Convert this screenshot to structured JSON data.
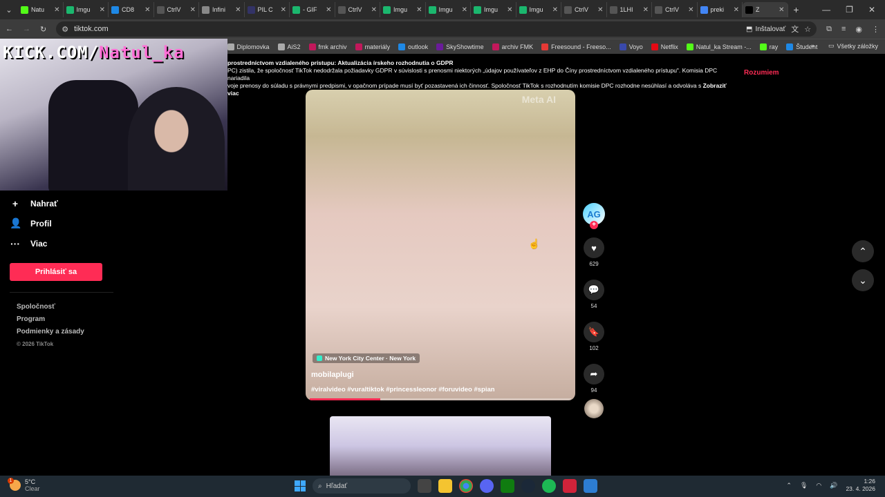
{
  "browser": {
    "tabs": [
      {
        "title": "Natu",
        "color": "#53fc18"
      },
      {
        "title": "Imgu",
        "color": "#1bb76e"
      },
      {
        "title": "CD8",
        "color": "#1e88e5"
      },
      {
        "title": "CtrlV",
        "color": "#555555"
      },
      {
        "title": "Infini",
        "color": "#888888"
      },
      {
        "title": "PIL C",
        "color": "#333366"
      },
      {
        "title": "- GIF",
        "color": "#1bb76e"
      },
      {
        "title": "CtrlV",
        "color": "#555555"
      },
      {
        "title": "Imgu",
        "color": "#1bb76e"
      },
      {
        "title": "Imgu",
        "color": "#1bb76e"
      },
      {
        "title": "Imgu",
        "color": "#1bb76e"
      },
      {
        "title": "Imgu",
        "color": "#1bb76e"
      },
      {
        "title": "CtrlV",
        "color": "#555555"
      },
      {
        "title": "1LHI",
        "color": "#555555"
      },
      {
        "title": "CtrlV",
        "color": "#555555"
      },
      {
        "title": "preki",
        "color": "#4285f4"
      },
      {
        "title": "Z",
        "color": "#000000",
        "active": true
      }
    ],
    "url": "tiktok.com",
    "install_label": "Inštalovať",
    "bookmarks": [
      {
        "label": "Diplomovka",
        "color": "#aaaaaa"
      },
      {
        "label": "AiS2",
        "color": "#aaaaaa"
      },
      {
        "label": "fmk archiv",
        "color": "#c2185b"
      },
      {
        "label": "materiály",
        "color": "#c2185b"
      },
      {
        "label": "outlook",
        "color": "#1e88e5"
      },
      {
        "label": "SkyShowtime",
        "color": "#6a1b9a"
      },
      {
        "label": "archiv FMK",
        "color": "#c2185b"
      },
      {
        "label": "Freesound - Freeso...",
        "color": "#e53935"
      },
      {
        "label": "Voyo",
        "color": "#3949ab"
      },
      {
        "label": "Netflix",
        "color": "#e50914"
      },
      {
        "label": "Natul_ka Stream -...",
        "color": "#53fc18"
      },
      {
        "label": "ray",
        "color": "#53fc18"
      },
      {
        "label": "Študent",
        "color": "#1e88e5"
      }
    ],
    "bookmarks_all": "Všetky záložky",
    "bookmarks_cut": "x"
  },
  "overlay": {
    "kick_prefix": "KICK.COM/",
    "kick_name": "Natul_ka"
  },
  "banner": {
    "title": "prostredníctvom vzdialeného prístupu: Aktualizácia írskeho rozhodnutia o GDPR",
    "line1": "PC) zistila, že spoločnosť TikTok nedodržala požiadavky GDPR v súvislosti s prenosmi niektorých „údajov používateľov z EHP do Číny prostredníctvom vzdialeného prístupu\". Komisia DPC nariadila",
    "line2": "voje prenosy do súladu s právnymi predpismi, v opačnom prípade musí byť pozastavená ich činnosť. Spoločnosť TikTok s rozhodnutím komisie DPC rozhodne nesúhlasí a odvoláva s",
    "more": "Zobraziť viac",
    "accept": "Rozumiem"
  },
  "sidebar": {
    "items": [
      {
        "label": "Nahrať",
        "icon": "+"
      },
      {
        "label": "Profil",
        "icon": "👤"
      },
      {
        "label": "Viac",
        "icon": "···"
      }
    ],
    "login": "Prihlásiť sa",
    "links": [
      "Spoločnosť",
      "Program",
      "Podmienky a zásady"
    ],
    "copyright": "© 2026 TikTok"
  },
  "video": {
    "watermark": "Meta AI",
    "location": "New York City Center · New York",
    "author": "mobilaplugi",
    "tags": "#viralvideo #vuraltiktok #princessleonor #foruvideo #spian",
    "progress": 0.27
  },
  "actions": {
    "avatar_text": "AG",
    "likes": "629",
    "comments": "54",
    "saves": "102",
    "shares": "94"
  },
  "taskbar": {
    "temp": "5°C",
    "weather": "Clear",
    "weather_badge": "1",
    "search_placeholder": "Hľadať",
    "time": "1:26",
    "date": "23. 4. 2026"
  }
}
